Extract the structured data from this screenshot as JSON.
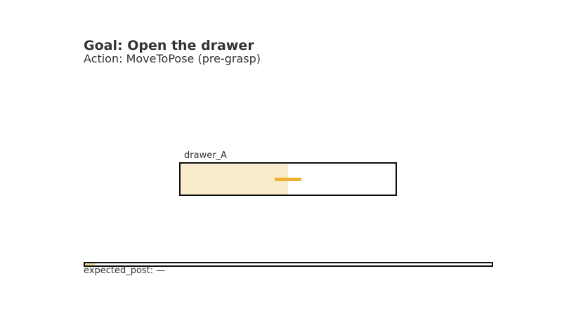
{
  "header": {
    "goal": "Goal: Open the drawer",
    "action": "Action: MoveToPose (pre-grasp)"
  },
  "drawer": {
    "name": "drawer_A",
    "open_fraction": 0.5,
    "colors": {
      "frame": "#111111",
      "open_region": "#faebcd",
      "handle": "#f0b030"
    }
  },
  "progress": {
    "fraction": 0.025,
    "fill_color": "#f5d9a0"
  },
  "footer": {
    "expected_post": "expected_post: —"
  }
}
